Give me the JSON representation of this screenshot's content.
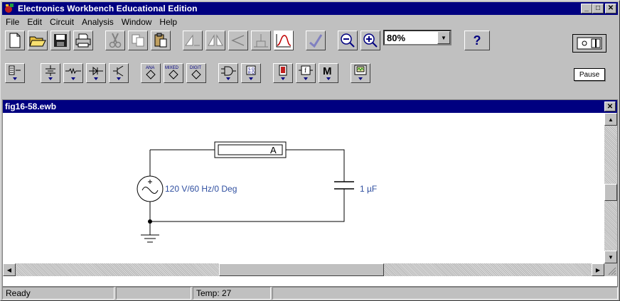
{
  "window": {
    "title": "Electronics Workbench Educational Edition"
  },
  "menu": {
    "items": [
      "File",
      "Edit",
      "Circuit",
      "Analysis",
      "Window",
      "Help"
    ]
  },
  "toolbar": {
    "zoom_value": "80%",
    "help_label": "?",
    "pause_label": "Pause"
  },
  "document": {
    "title": "fig16-58.ewb"
  },
  "circuit": {
    "source_label": "120 V/60 Hz/0 Deg",
    "capacitor_label": "1 µF",
    "ammeter_label": "A"
  },
  "statusbar": {
    "status": "Ready",
    "temp": "Temp: 27"
  },
  "colors": {
    "titlebar": "#000080",
    "component_text": "#2f4fa0",
    "face": "#c0c0c0"
  }
}
